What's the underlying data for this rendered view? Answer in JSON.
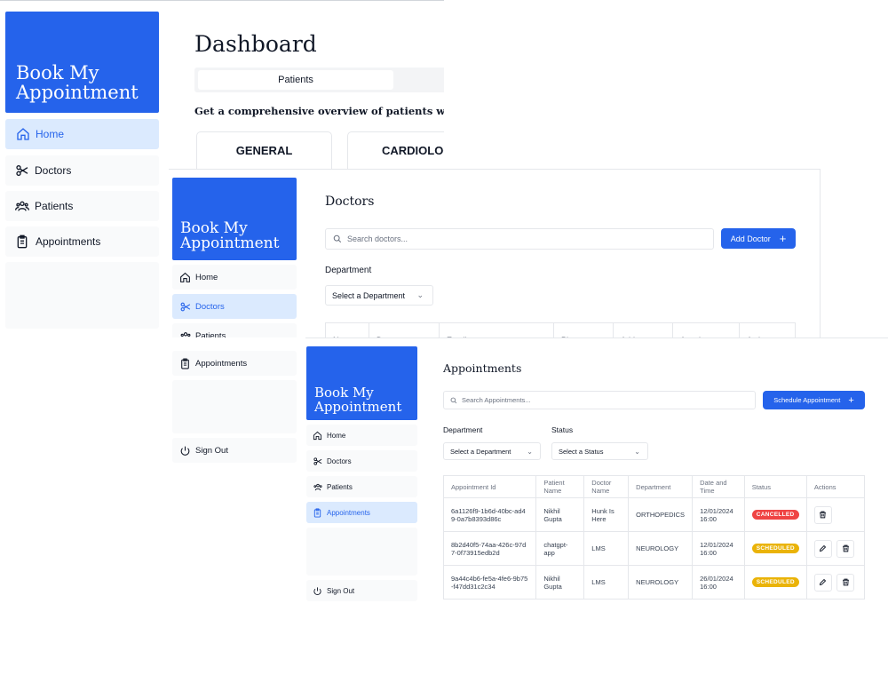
{
  "brand": {
    "line1": "Book My",
    "line2": "Appointment"
  },
  "nav": {
    "home": "Home",
    "doctors": "Doctors",
    "patients": "Patients",
    "appointments": "Appointments",
    "sign_out": "Sign Out"
  },
  "dashboard": {
    "title": "Dashboard",
    "tab_patients": "Patients",
    "description": "Get a comprehensive overview of patients with upcomi",
    "cards": [
      "GENERAL",
      "CARDIOLOG"
    ]
  },
  "doctors": {
    "title": "Doctors",
    "search_placeholder": "Search doctors...",
    "add_button": "Add Doctor",
    "department_label": "Department",
    "department_select": "Select a Department",
    "columns": [
      "Name",
      "Department",
      "Email",
      "Phone",
      "Address",
      "Appointments",
      "Actions"
    ]
  },
  "appointments": {
    "title": "Appointments",
    "search_placeholder": "Search Appointments...",
    "schedule_button": "Schedule Appointment",
    "department_label": "Department",
    "status_label": "Status",
    "department_select": "Select a Department",
    "status_select": "Select a Status",
    "columns": [
      "Appointment Id",
      "Patient Name",
      "Doctor Name",
      "Department",
      "Date and Time",
      "Status",
      "Actions"
    ],
    "rows": [
      {
        "id": "6a1126f9-1b6d-40bc-ad49-0a7b8393d86c",
        "patient": "Nikhil Gupta",
        "doctor": "Hunk Is Here",
        "department": "ORTHOPEDICS",
        "datetime": "12/01/2024 16:00",
        "status": "CANCELLED"
      },
      {
        "id": "8b2d40f5-74aa-426c-97d7-0f73915edb2d",
        "patient": "chatgpt-app",
        "doctor": "LMS",
        "department": "NEUROLOGY",
        "datetime": "12/01/2024 16:00",
        "status": "SCHEDULED"
      },
      {
        "id": "9a44c4b6-fe5a-4fe6-9b75-f47dd31c2c34",
        "patient": "Nikhil Gupta",
        "doctor": "LMS",
        "department": "NEUROLOGY",
        "datetime": "26/01/2024 16:00",
        "status": "SCHEDULED"
      }
    ]
  },
  "colors": {
    "accent": "#2563eb",
    "active_bg": "#dbeafe",
    "cancelled": "#ef4444",
    "scheduled": "#eab308"
  }
}
